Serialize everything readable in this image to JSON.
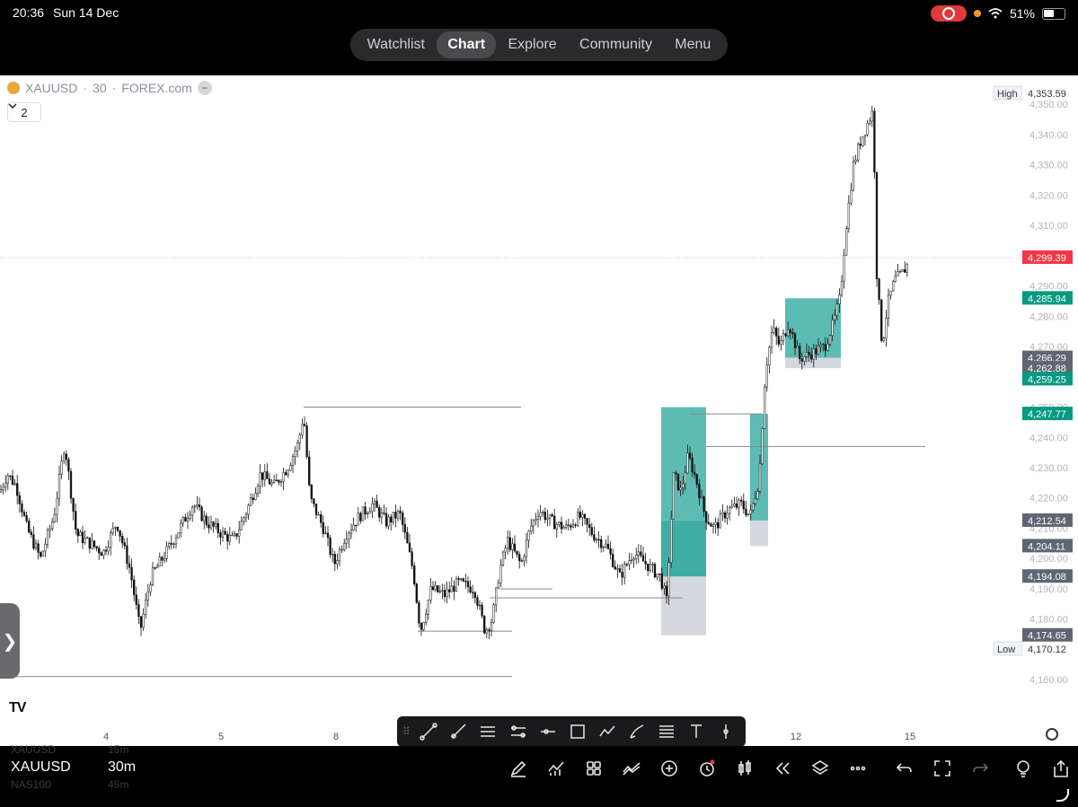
{
  "status": {
    "time": "20:36",
    "date": "Sun 14 Dec",
    "battery": "51%"
  },
  "topnav": {
    "tabs": [
      "Watchlist",
      "Chart",
      "Explore",
      "Community",
      "Menu"
    ],
    "active_index": 1
  },
  "chart_header": {
    "symbol": "XAUUSD",
    "interval": "30",
    "exchange": "FOREX.com",
    "separator": "·",
    "indicator_count": "2"
  },
  "chart_data": {
    "type": "candlestick",
    "symbol": "XAUUSD",
    "ylim": [
      4155,
      4356
    ],
    "y_ticks": [
      "4,160.00",
      "4,170.00",
      "4,180.00",
      "4,190.00",
      "4,200.00",
      "4,210.00",
      "4,220.00",
      "4,230.00",
      "4,240.00",
      "4,250.00",
      "4,260.00",
      "4,270.00",
      "4,280.00",
      "4,290.00",
      "4,300.00",
      "4,310.00",
      "4,320.00",
      "4,330.00",
      "4,340.00",
      "4,350.00"
    ],
    "x_ticks": [
      "4",
      "5",
      "8",
      "12",
      "15"
    ],
    "price_path": [
      [
        0,
        4222
      ],
      [
        8,
        4228
      ],
      [
        18,
        4224
      ],
      [
        30,
        4210
      ],
      [
        45,
        4200
      ],
      [
        60,
        4214
      ],
      [
        72,
        4238
      ],
      [
        85,
        4208
      ],
      [
        100,
        4205
      ],
      [
        115,
        4202
      ],
      [
        130,
        4212
      ],
      [
        145,
        4196
      ],
      [
        156,
        4176
      ],
      [
        168,
        4194
      ],
      [
        185,
        4202
      ],
      [
        200,
        4210
      ],
      [
        215,
        4218
      ],
      [
        230,
        4212
      ],
      [
        248,
        4208
      ],
      [
        260,
        4206
      ],
      [
        275,
        4216
      ],
      [
        290,
        4228
      ],
      [
        305,
        4224
      ],
      [
        320,
        4230
      ],
      [
        332,
        4238
      ],
      [
        338,
        4248
      ],
      [
        345,
        4220
      ],
      [
        360,
        4210
      ],
      [
        372,
        4198
      ],
      [
        385,
        4208
      ],
      [
        400,
        4214
      ],
      [
        415,
        4218
      ],
      [
        430,
        4212
      ],
      [
        445,
        4215
      ],
      [
        460,
        4196
      ],
      [
        468,
        4176
      ],
      [
        480,
        4190
      ],
      [
        495,
        4188
      ],
      [
        510,
        4192
      ],
      [
        528,
        4190
      ],
      [
        540,
        4176
      ],
      [
        548,
        4180
      ],
      [
        556,
        4196
      ],
      [
        565,
        4206
      ],
      [
        580,
        4198
      ],
      [
        590,
        4210
      ],
      [
        600,
        4216
      ],
      [
        615,
        4212
      ],
      [
        630,
        4210
      ],
      [
        645,
        4214
      ],
      [
        660,
        4208
      ],
      [
        675,
        4204
      ],
      [
        690,
        4194
      ],
      [
        705,
        4202
      ],
      [
        720,
        4198
      ],
      [
        735,
        4194
      ],
      [
        742,
        4186
      ],
      [
        750,
        4228
      ],
      [
        758,
        4222
      ],
      [
        766,
        4234
      ],
      [
        775,
        4226
      ],
      [
        785,
        4214
      ],
      [
        795,
        4210
      ],
      [
        810,
        4216
      ],
      [
        825,
        4218
      ],
      [
        835,
        4214
      ],
      [
        845,
        4226
      ],
      [
        852,
        4262
      ],
      [
        860,
        4276
      ],
      [
        868,
        4270
      ],
      [
        878,
        4278
      ],
      [
        890,
        4266
      ],
      [
        905,
        4268
      ],
      [
        918,
        4270
      ],
      [
        928,
        4278
      ],
      [
        935,
        4286
      ],
      [
        942,
        4310
      ],
      [
        950,
        4330
      ],
      [
        958,
        4338
      ],
      [
        966,
        4344
      ],
      [
        972,
        4348
      ],
      [
        976,
        4294
      ],
      [
        982,
        4270
      ],
      [
        988,
        4284
      ],
      [
        996,
        4292
      ],
      [
        1004,
        4294
      ],
      [
        1012,
        4298
      ]
    ],
    "high": {
      "label": "High",
      "value": "4,353.59"
    },
    "low": {
      "label": "Low",
      "value": "4,170.12"
    },
    "price_labels": [
      {
        "value": "4,299.39",
        "price": 4299.39,
        "kind": "current",
        "color": "#f23645"
      },
      {
        "value": "4,285.94",
        "price": 4285.94,
        "kind": "zone",
        "color": "#089981"
      },
      {
        "value": "4,266.29",
        "price": 4266.29,
        "kind": "gray",
        "color": "#5f6673"
      },
      {
        "value": "4,262.88",
        "price": 4262.88,
        "kind": "gray",
        "color": "#5f6673"
      },
      {
        "value": "4,259.25",
        "price": 4259.25,
        "kind": "zone",
        "color": "#089981"
      },
      {
        "value": "4,247.77",
        "price": 4247.77,
        "kind": "zone",
        "color": "#089981"
      },
      {
        "value": "4,212.54",
        "price": 4212.54,
        "kind": "gray",
        "color": "#5f6673"
      },
      {
        "value": "4,204.11",
        "price": 4204.11,
        "kind": "gray",
        "color": "#5f6673"
      },
      {
        "value": "4,194.08",
        "price": 4194.08,
        "kind": "gray",
        "color": "#5f6673"
      },
      {
        "value": "4,174.65",
        "price": 4174.65,
        "kind": "gray",
        "color": "#5f6673"
      }
    ],
    "zones": [
      {
        "name": "zone-1",
        "x0": 736,
        "x1": 786,
        "target_top": 4250,
        "entry": 4212.54,
        "stop": 4174.65,
        "mid": 4194.08
      },
      {
        "name": "zone-2",
        "x0": 835,
        "x1": 855,
        "target_top": 4247.77,
        "entry": 4212.54,
        "stop": 4204.11
      },
      {
        "name": "zone-3",
        "x0": 874,
        "x1": 936,
        "target_top": 4285.94,
        "entry": 4266.29,
        "stop": 4262.88
      }
    ],
    "lines": [
      {
        "name": "line-high-left",
        "price": 4250,
        "x0": 338,
        "x1": 580
      },
      {
        "name": "line-low-left",
        "price": 4161,
        "x0": 0,
        "x1": 570
      },
      {
        "name": "line-mid-right",
        "price": 4237,
        "x0": 786,
        "x1": 1030
      },
      {
        "name": "line-mid-2",
        "price": 4247.77,
        "x0": 768,
        "x1": 848
      },
      {
        "name": "line-low-a",
        "price": 4176,
        "x0": 465,
        "x1": 570
      },
      {
        "name": "line-low-b",
        "price": 4190,
        "x0": 556,
        "x1": 615
      },
      {
        "name": "line-low-c",
        "price": 4187,
        "x0": 545,
        "x1": 760
      },
      {
        "name": "line-current",
        "price": 4299.39,
        "x0": 0,
        "x1": 1135
      }
    ],
    "colors": {
      "zone_green": "#26a69a",
      "zone_gray": "#d1d4dc",
      "current": "#f23645",
      "label_green": "#089981",
      "label_gray": "#5f6673"
    }
  },
  "drawing_tools": [
    "trend-line-icon",
    "ray-icon",
    "parallel-channel-icon",
    "regression-icon",
    "horizontal-line-icon",
    "rectangle-icon",
    "path-icon",
    "brush-icon",
    "fib-icon",
    "text-icon",
    "vertical-line-icon"
  ],
  "bottombar": {
    "symbol": "XAUUSD",
    "interval": "30m",
    "ghost_prev_symbol": "XAUUSD",
    "ghost_prev_interval": "15m",
    "ghost_next_symbol": "NAS100",
    "ghost_next_interval": "45m"
  },
  "bottom_icons": [
    "pencil-icon",
    "indicators-icon",
    "layout-grid-icon",
    "compare-icon",
    "add-icon",
    "alert-icon",
    "candle-type-icon",
    "replay-icon",
    "layers-icon",
    "more-icon",
    "undo-icon",
    "fullscreen-icon",
    "redo-icon",
    "idea-icon",
    "share-icon"
  ]
}
